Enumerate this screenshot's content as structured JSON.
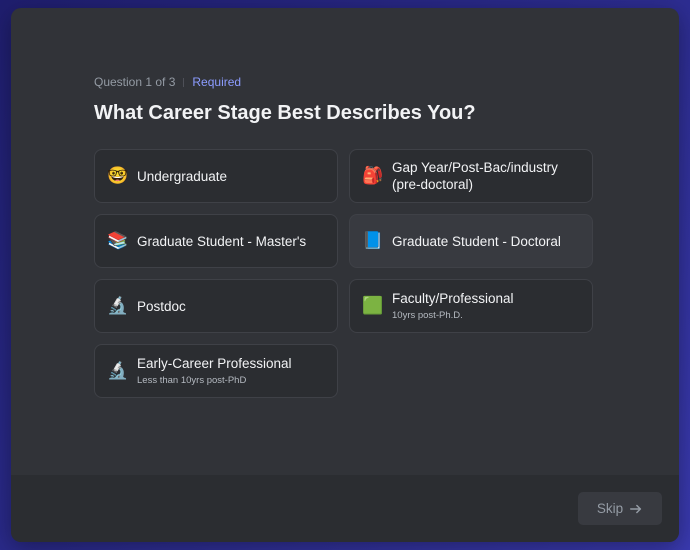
{
  "question": {
    "progress": "Question 1 of 3",
    "required": "Required",
    "title": "What Career Stage Best Describes You?"
  },
  "options": [
    {
      "icon": "nerd-face-icon",
      "glyph": "🤓",
      "label": "Undergraduate",
      "sub": ""
    },
    {
      "icon": "school-backpack-icon",
      "glyph": "🎒",
      "label": "Gap Year/Post-Bac/industry (pre-doctoral)",
      "sub": ""
    },
    {
      "icon": "books-icon",
      "glyph": "📚",
      "label": "Graduate Student - Master's",
      "sub": ""
    },
    {
      "icon": "degree-book-icon",
      "glyph": "📘",
      "label": "Graduate Student - Doctoral",
      "sub": ""
    },
    {
      "icon": "microscope-icon",
      "glyph": "🔬",
      "label": "Postdoc",
      "sub": ""
    },
    {
      "icon": "chalkboard-icon",
      "glyph": "🟩",
      "label": "Faculty/Professional",
      "sub": "10yrs post-Ph.D."
    },
    {
      "icon": "microscope-icon",
      "glyph": "🔬",
      "label": "Early-Career Professional",
      "sub": "Less than 10yrs post-PhD"
    }
  ],
  "footer": {
    "skip_label": "Skip"
  },
  "colors": {
    "accent": "#8c9cff",
    "modal_bg": "#313338",
    "option_bg": "#2b2d31",
    "footer_bg": "#2b2d31"
  }
}
